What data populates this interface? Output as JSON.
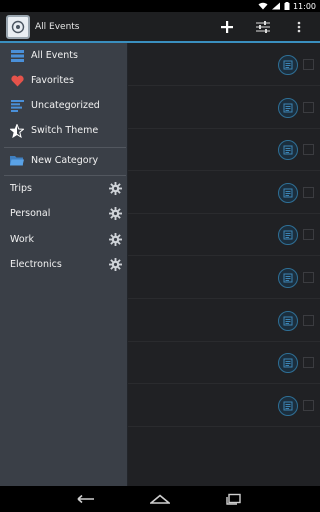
{
  "status_bar": {
    "time": "11:00",
    "icons": [
      "wifi-icon",
      "signal-icon",
      "battery-icon"
    ]
  },
  "action_bar": {
    "title": "All Events",
    "actions": [
      "add-icon",
      "filter-sliders-icon",
      "overflow-menu-icon"
    ],
    "accent": "#3a8fbf"
  },
  "drawer": {
    "items": [
      {
        "label": "All Events",
        "icon": "list-icon",
        "color": "#4a90d9"
      },
      {
        "label": "Favorites",
        "icon": "heart-icon",
        "color": "#e5534b"
      },
      {
        "label": "Uncategorized",
        "icon": "lines-icon",
        "color": "#4a90d9"
      },
      {
        "label": "Switch Theme",
        "icon": "star-half-icon",
        "color": "#ffffff"
      },
      {
        "label": "New Category",
        "icon": "folder-icon",
        "color": "#4a90d9"
      }
    ],
    "categories": [
      "Trips",
      "Personal",
      "Work",
      "Electronics"
    ]
  },
  "event_list": {
    "row_count": 9
  },
  "nav_bar": {
    "buttons": [
      "back-icon",
      "home-icon",
      "recents-icon"
    ]
  }
}
